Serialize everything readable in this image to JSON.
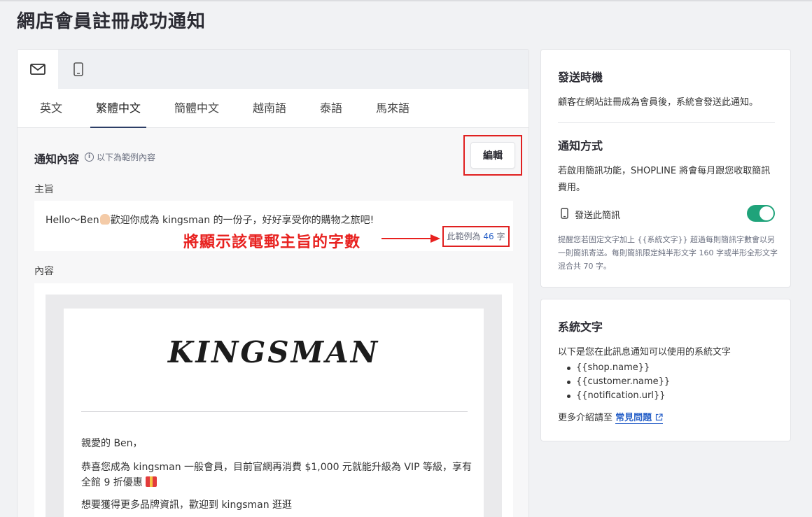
{
  "page_title": "網店會員註冊成功通知",
  "channel_tabs": [
    {
      "name": "email",
      "icon": "mail-icon",
      "active": true
    },
    {
      "name": "sms",
      "icon": "mobile-icon",
      "active": false
    }
  ],
  "language_tabs": [
    {
      "label": "英文",
      "active": false
    },
    {
      "label": "繁體中文",
      "active": true
    },
    {
      "label": "簡體中文",
      "active": false
    },
    {
      "label": "越南語",
      "active": false
    },
    {
      "label": "泰語",
      "active": false
    },
    {
      "label": "馬來語",
      "active": false
    }
  ],
  "notification": {
    "section_title": "通知內容",
    "hint": "以下為範例內容",
    "edit_label": "編輯",
    "subject_label": "主旨",
    "subject_before": "Hello～Ben",
    "subject_after": "歡迎你成為 kingsman 的一份子，好好享受你的購物之旅吧!",
    "count_prefix": "此範例為",
    "count_value": "46",
    "count_suffix": "字",
    "annotation": "將顯示該電郵主旨的字數",
    "content_label": "內容"
  },
  "email_preview": {
    "brand": "KINGSMAN",
    "greeting": "親愛的 Ben，",
    "body_1": "恭喜您成為 kingsman 一般會員，目前官網再消費 $1,000 元就能升級為 VIP 等級，享有全館 9 折優惠",
    "body_2": "想要獲得更多品牌資訊，歡迎到 kingsman 逛逛"
  },
  "send_panel": {
    "timing_title": "發送時機",
    "timing_text": "顧客在網站註冊成為會員後，系統會發送此通知。",
    "method_title": "通知方式",
    "method_text": "若啟用簡訊功能，SHOPLINE 將會每月跟您收取簡訊費用。",
    "sms_label": "發送此簡訊",
    "sms_enabled": true,
    "sms_note": "提醒您若固定文字加上 {{系統文字}} 超過每則簡訊字數會以另一則簡訊寄送。每則簡訊限定純半形文字 160 字或半形全形文字混合共 70 字。"
  },
  "system_panel": {
    "title": "系統文字",
    "intro": "以下是您在此訊息通知可以使用的系統文字",
    "variables": [
      "{{shop.name}}",
      "{{customer.name}}",
      "{{notification.url}}"
    ],
    "faq_prefix": "更多介紹請至",
    "faq_link": "常見問題"
  },
  "colors": {
    "accent_green": "#1fa37a",
    "link_blue": "#2a62c9",
    "annotation_red": "#e8211f"
  }
}
